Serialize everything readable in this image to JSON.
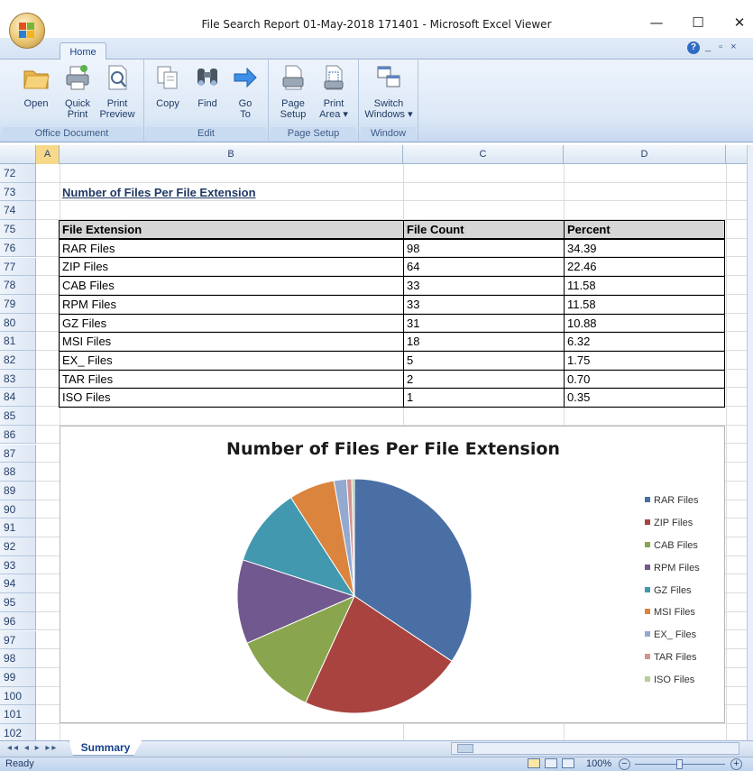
{
  "window": {
    "title": "File Search Report 01-May-2018 171401 - Microsoft Excel Viewer",
    "minimize": "—",
    "maximize": "☐",
    "close": "✕"
  },
  "ribbon": {
    "tab": "Home",
    "groups": [
      {
        "label": "Office Document",
        "buttons": [
          {
            "line1": "Open",
            "line2": ""
          },
          {
            "line1": "Quick",
            "line2": "Print"
          },
          {
            "line1": "Print",
            "line2": "Preview"
          }
        ]
      },
      {
        "label": "Edit",
        "buttons": [
          {
            "line1": "Copy",
            "line2": ""
          },
          {
            "line1": "Find",
            "line2": ""
          },
          {
            "line1": "Go",
            "line2": "To"
          }
        ]
      },
      {
        "label": "Page Setup",
        "buttons": [
          {
            "line1": "Page",
            "line2": "Setup"
          },
          {
            "line1": "Print",
            "line2": "Area ▾"
          }
        ]
      },
      {
        "label": "Window",
        "buttons": [
          {
            "line1": "Switch",
            "line2": "Windows ▾"
          }
        ]
      }
    ],
    "help": "?",
    "mini_controls": "_ ▫ ×"
  },
  "sheet": {
    "corner": "",
    "columns": [
      "A",
      "B",
      "C",
      "D"
    ],
    "rows": [
      "72",
      "73",
      "74",
      "75",
      "76",
      "77",
      "78",
      "79",
      "80",
      "81",
      "82",
      "83",
      "84",
      "85",
      "86",
      "87",
      "88",
      "89",
      "90",
      "91",
      "92",
      "93",
      "94",
      "95",
      "96",
      "97",
      "98",
      "99",
      "100",
      "101",
      "102"
    ],
    "heading": "Number of Files Per File Extension",
    "table": {
      "headers": [
        "File Extension",
        "File Count",
        "Percent"
      ],
      "rows": [
        [
          "RAR Files",
          "98",
          "34.39"
        ],
        [
          "ZIP Files",
          "64",
          "22.46"
        ],
        [
          "CAB Files",
          "33",
          "11.58"
        ],
        [
          "RPM Files",
          "33",
          "11.58"
        ],
        [
          "GZ Files",
          "31",
          "10.88"
        ],
        [
          "MSI Files",
          "18",
          "6.32"
        ],
        [
          "EX_ Files",
          "5",
          "1.75"
        ],
        [
          "TAR Files",
          "2",
          "0.70"
        ],
        [
          "ISO Files",
          "1",
          "0.35"
        ]
      ]
    }
  },
  "chart_data": {
    "type": "pie",
    "title": "Number of Files Per File Extension",
    "categories": [
      "RAR Files",
      "ZIP Files",
      "CAB Files",
      "RPM Files",
      "GZ Files",
      "MSI Files",
      "EX_ Files",
      "TAR Files",
      "ISO Files"
    ],
    "values": [
      98,
      64,
      33,
      33,
      31,
      18,
      5,
      2,
      1
    ],
    "colors": [
      "#4a6fa5",
      "#a9433f",
      "#89a54e",
      "#71588f",
      "#4198af",
      "#db843d",
      "#93a9cf",
      "#d19392",
      "#b9cd96"
    ],
    "legend": "right"
  },
  "bottom": {
    "sheet_tab": "Summary",
    "nav": "◂◂ ◂ ▸ ▸▸",
    "status": "Ready",
    "zoom": "100%",
    "zoom_out": "−",
    "zoom_in": "+"
  }
}
